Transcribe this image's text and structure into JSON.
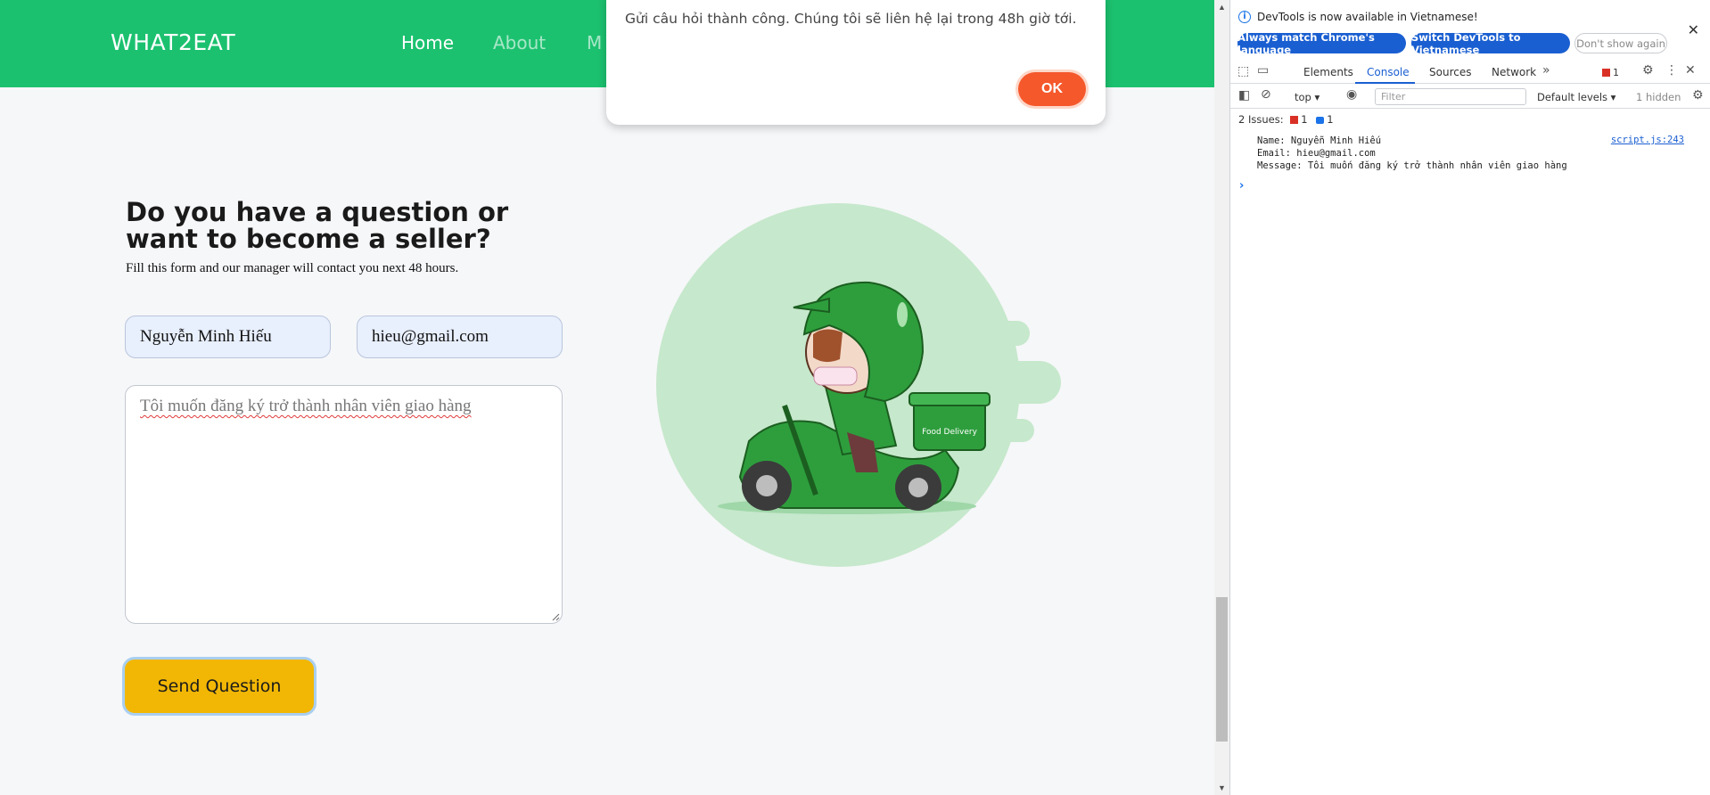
{
  "site": {
    "brand": "WHAT2EAT",
    "nav": [
      {
        "label": "Home",
        "active": true
      },
      {
        "label": "About",
        "active": false
      },
      {
        "label": "M",
        "active": false
      }
    ],
    "form": {
      "heading": "Do you have a question or want to become a seller?",
      "subtext": "Fill this form and our manager will contact you next 48 hours.",
      "name_value": "Nguyễn Minh Hiếu",
      "email_value": "hieu@gmail.com",
      "message_value": "Tôi muốn đăng ký trở thành nhân viên giao hàng",
      "submit_label": "Send Question"
    },
    "illustration": {
      "box_text": "Food Delivery",
      "accent": "#1cc16f",
      "scooter_color": "#2e9e3d"
    },
    "colors": {
      "nav_bg": "#1cc16f",
      "submit_bg": "#f2b705",
      "ok_bg": "#f5582b"
    }
  },
  "alert": {
    "message": "Gửi câu hỏi thành công. Chúng tôi sẽ liên hệ lại trong 48h giờ tới.",
    "ok_label": "OK"
  },
  "devtools": {
    "banner": {
      "text": "DevTools is now available in Vietnamese!",
      "btn_match": "Always match Chrome's language",
      "btn_switch": "Switch DevTools to Vietnamese",
      "btn_dont_show": "Don't show again"
    },
    "tabs": [
      {
        "label": "Elements",
        "active": false
      },
      {
        "label": "Console",
        "active": true
      },
      {
        "label": "Sources",
        "active": false
      },
      {
        "label": "Network",
        "active": false
      }
    ],
    "error_count": "1",
    "toolbar": {
      "context": "top",
      "filter_placeholder": "Filter",
      "levels": "Default levels",
      "hidden": "1 hidden"
    },
    "issues": {
      "label": "2 Issues:",
      "errors": "1",
      "messages": "1"
    },
    "log": {
      "lines": [
        "Name: Nguyễn Minh Hiếu",
        "Email: hieu@gmail.com",
        "Message: Tôi muốn đăng ký trở thành nhân viên giao hàng"
      ],
      "source": "script.js:243"
    }
  }
}
